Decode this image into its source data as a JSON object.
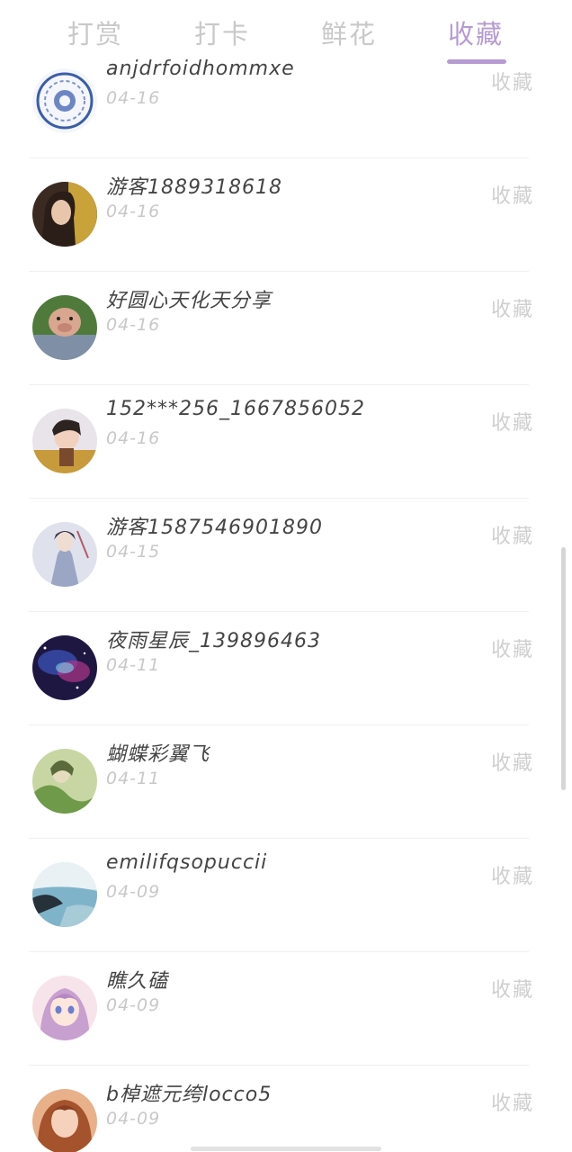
{
  "tabs": [
    {
      "label": "打赏",
      "active": false
    },
    {
      "label": "打卡",
      "active": false
    },
    {
      "label": "鲜花",
      "active": false
    },
    {
      "label": "收藏",
      "active": true
    }
  ],
  "accent_color": "#b69bd2",
  "list": [
    {
      "name": "anjdrfoidhommxe",
      "date": "04-16",
      "action": "收藏",
      "avatar": "porcelain-plate-avatar"
    },
    {
      "name": "游客1889318618",
      "date": "04-16",
      "action": "收藏",
      "avatar": "woman-portrait-avatar"
    },
    {
      "name": "好圆心天化天分享",
      "date": "04-16",
      "action": "收藏",
      "avatar": "pig-figure-avatar"
    },
    {
      "name": "152***256_1667856052",
      "date": "04-16",
      "action": "收藏",
      "avatar": "child-portrait-avatar"
    },
    {
      "name": "游客1587546901890",
      "date": "04-15",
      "action": "收藏",
      "avatar": "ink-painting-avatar"
    },
    {
      "name": "夜雨星辰_139896463",
      "date": "04-11",
      "action": "收藏",
      "avatar": "galaxy-avatar"
    },
    {
      "name": "蝴蝶彩翼飞",
      "date": "04-11",
      "action": "收藏",
      "avatar": "green-painting-avatar"
    },
    {
      "name": "emilifqsopuccii",
      "date": "04-09",
      "action": "收藏",
      "avatar": "lake-scenery-avatar"
    },
    {
      "name": "瞧久磕",
      "date": "04-09",
      "action": "收藏",
      "avatar": "anime-girl-avatar"
    },
    {
      "name": "b棹遮元绔locco5",
      "date": "04-09",
      "action": "收藏",
      "avatar": "girl-photo-avatar"
    }
  ]
}
